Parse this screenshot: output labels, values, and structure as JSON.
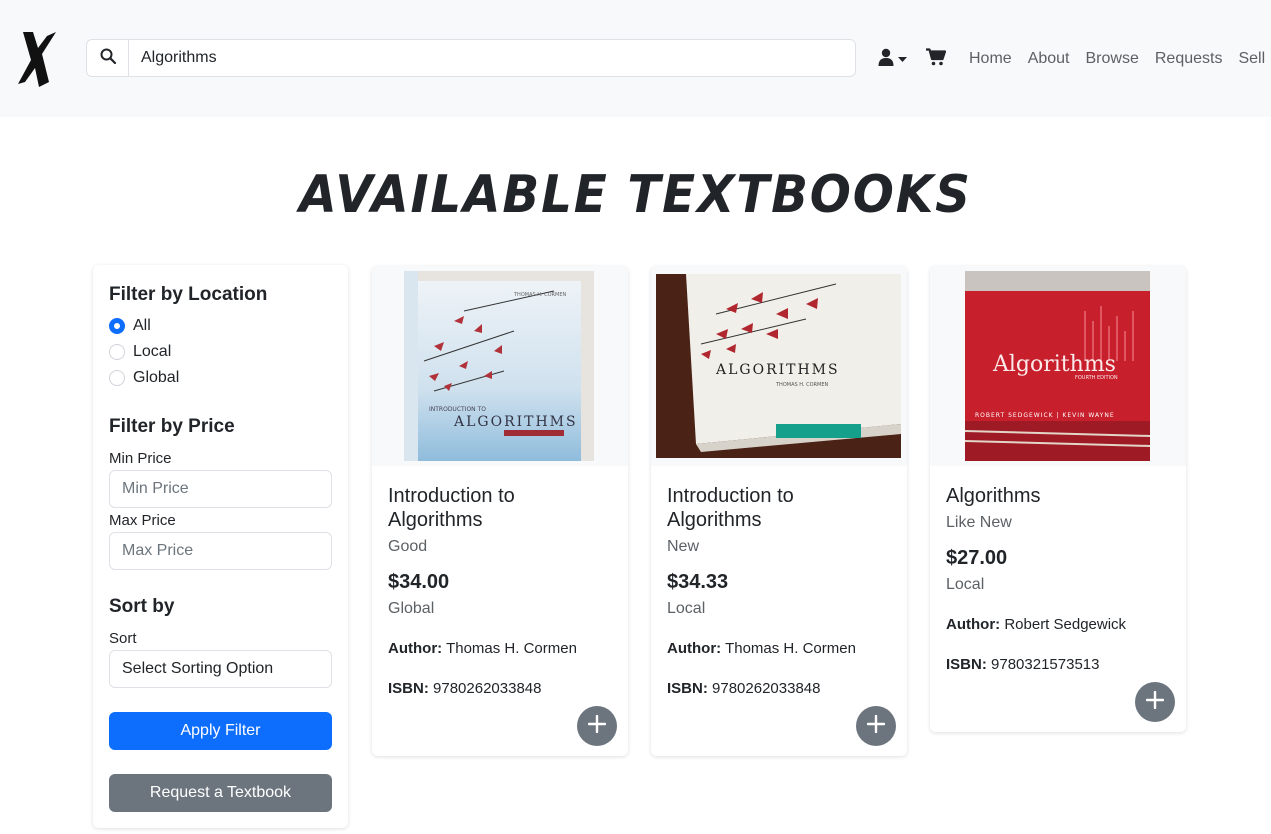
{
  "navbar": {
    "search_value": "Algorithms",
    "links": [
      "Home",
      "About",
      "Browse",
      "Requests",
      "Sell"
    ]
  },
  "page_title": "AVAILABLE TEXTBOOKS",
  "sidebar": {
    "location_heading": "Filter by Location",
    "location_options": [
      {
        "label": "All",
        "checked": true
      },
      {
        "label": "Local",
        "checked": false
      },
      {
        "label": "Global",
        "checked": false
      }
    ],
    "price_heading": "Filter by Price",
    "min_label": "Min Price",
    "min_placeholder": "Min Price",
    "max_label": "Max Price",
    "max_placeholder": "Max Price",
    "sort_heading": "Sort by",
    "sort_label": "Sort",
    "sort_value": "Select Sorting Option",
    "apply_label": "Apply Filter",
    "request_label": "Request a Textbook"
  },
  "books": [
    {
      "title": "Introduction to Algorithms",
      "condition": "Good",
      "price": "$34.00",
      "location": "Global",
      "author_label": "Author:",
      "author": "Thomas H. Cormen",
      "isbn_label": "ISBN:",
      "isbn": "9780262033848"
    },
    {
      "title": "Introduction to Algorithms",
      "condition": "New",
      "price": "$34.33",
      "location": "Local",
      "author_label": "Author:",
      "author": "Thomas H. Cormen",
      "isbn_label": "ISBN:",
      "isbn": "9780262033848"
    },
    {
      "title": "Algorithms",
      "condition": "Like New",
      "price": "$27.00",
      "location": "Local",
      "author_label": "Author:",
      "author": "Robert Sedgewick",
      "isbn_label": "ISBN:",
      "isbn": "9780321573513"
    }
  ],
  "colors": {
    "primary": "#0d6efd",
    "secondary": "#6c757d",
    "navbar_bg": "#f8f9fa"
  },
  "icons": [
    "logo-x-icon",
    "search-icon",
    "user-icon",
    "caret-down-icon",
    "cart-icon",
    "plus-icon"
  ]
}
